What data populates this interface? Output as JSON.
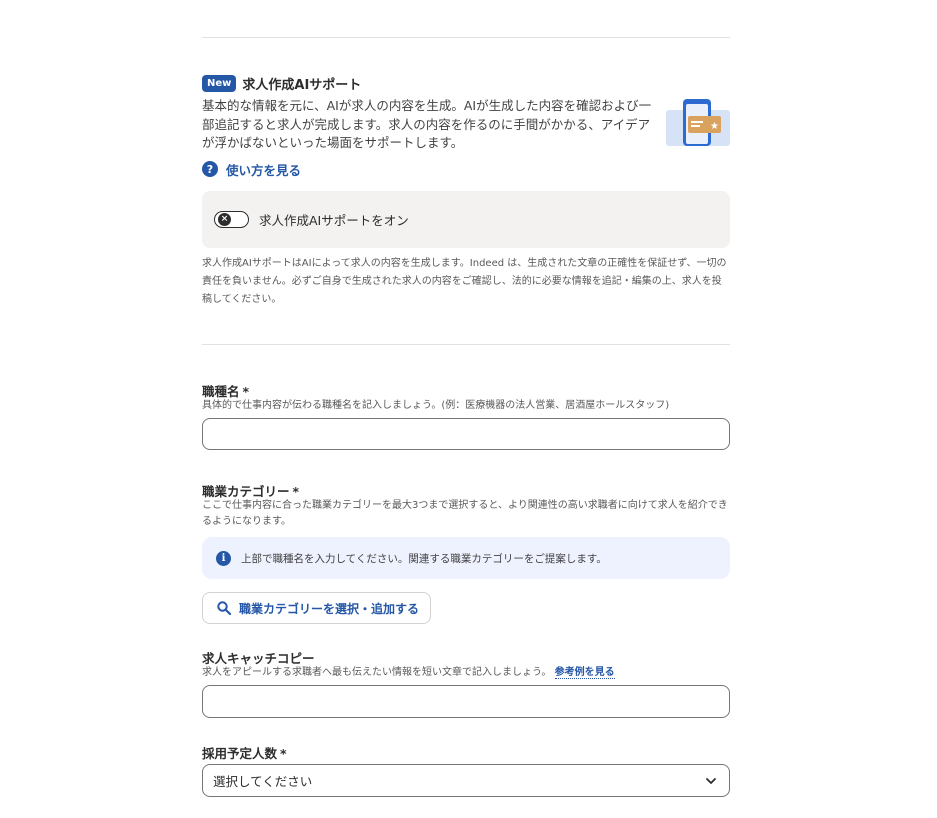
{
  "ai_support": {
    "badge": "New",
    "title": "求人作成AIサポート",
    "description": "基本的な情報を元に、AIが求人の内容を生成。AIが生成した内容を確認および一部追記すると求人が完成します。求人の内容を作るのに手間がかかる、アイデアが浮かばないといった場面をサポートします。",
    "howto_link": "使い方を見る",
    "toggle_label": "求人作成AIサポートをオン",
    "toggle_state": "off",
    "disclaimer": "求人作成AIサポートはAIによって求人の内容を生成します。Indeed は、生成された文章の正確性を保証せず、一切の責任を負いません。必ずご自身で生成された求人の内容をご確認し、法的に必要な情報を追記・編集の上、求人を投稿してください。"
  },
  "form": {
    "job_title": {
      "label": "職種名",
      "required_mark": "*",
      "help": "具体的で仕事内容が伝わる職種名を記入しましょう。(例：医療機器の法人営業、居酒屋ホールスタッフ)",
      "value": ""
    },
    "job_category": {
      "label": "職業カテゴリー",
      "required_mark": "*",
      "help": "ここで仕事内容に合った職業カテゴリーを最大3つまで選択すると、より関連性の高い求職者に向けて求人を紹介できるようになります。",
      "info": "上部で職種名を入力してください。関連する職業カテゴリーをご提案します。",
      "button_label": "職業カテゴリーを選択・追加する"
    },
    "catch_copy": {
      "label": "求人キャッチコピー",
      "help": "求人をアピールする求職者へ最も伝えたい情報を短い文章で記入しましょう。",
      "example_link": "参考例を見る",
      "value": ""
    },
    "headcount": {
      "label": "採用予定人数",
      "required_mark": "*",
      "selected": "選択してください"
    }
  },
  "colors": {
    "accent": "#2557a7",
    "info_bg": "#eef1fe",
    "toggle_box_bg": "#f3f2f1"
  }
}
